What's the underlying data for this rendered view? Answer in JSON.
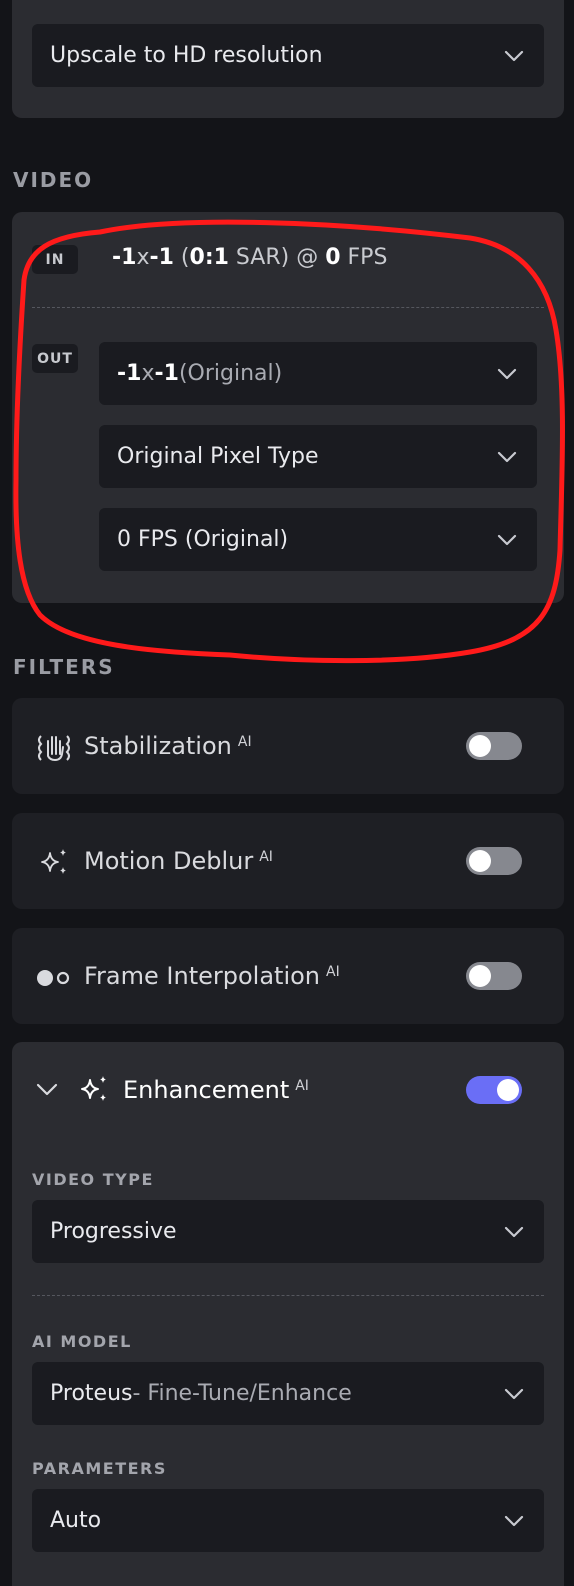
{
  "top_card": {
    "select_value": "Upscale to HD resolution"
  },
  "video": {
    "section_label": "VIDEO",
    "in_tag": "IN",
    "in_width": "-1",
    "in_x": "x",
    "in_height": "-1",
    "in_par_open": " (",
    "in_sar_value": "0:1",
    "in_sar_label": " SAR) @ ",
    "in_fps_value": "0",
    "in_fps_label": " FPS",
    "out_tag": "OUT",
    "resolution_width": "-1",
    "resolution_x": "x",
    "resolution_height": "-1",
    "resolution_suffix": " (Original)",
    "pixel_type": "Original Pixel Type",
    "fps": "0 FPS (Original)"
  },
  "filters": {
    "section_label": "FILTERS",
    "items": [
      {
        "label": "Stabilization",
        "badge": "AI",
        "enabled": false,
        "icon": "stabilization-icon"
      },
      {
        "label": "Motion Deblur",
        "badge": "AI",
        "enabled": false,
        "icon": "sparkles-icon"
      },
      {
        "label": "Frame Interpolation",
        "badge": "AI",
        "enabled": false,
        "icon": "frame-interpolation-icon"
      },
      {
        "label": "Enhancement",
        "badge": "AI",
        "enabled": true,
        "icon": "sparkles-icon"
      }
    ]
  },
  "enhancement": {
    "video_type_label": "VIDEO TYPE",
    "video_type_value": "Progressive",
    "ai_model_label": "AI MODEL",
    "ai_model_name": "Proteus",
    "ai_model_desc": " - Fine-Tune/Enhance",
    "parameters_label": "PARAMETERS",
    "parameters_value": "Auto"
  },
  "colors": {
    "background": "#131418",
    "card": "#2b2c31",
    "filter_card": "#1e1f24",
    "select": "#1a1b20",
    "toggle_on": "#6a6ef6",
    "toggle_off": "#86888f",
    "annotation": "#ff1a1a"
  }
}
